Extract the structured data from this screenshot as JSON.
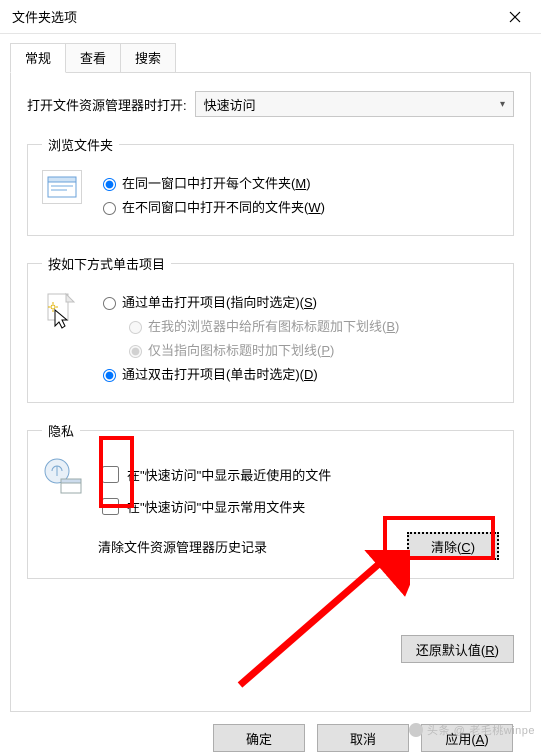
{
  "window": {
    "title": "文件夹选项"
  },
  "tabs": {
    "general": "常规",
    "view": "查看",
    "search": "搜索"
  },
  "open": {
    "label": "打开文件资源管理器时打开:",
    "value": "快速访问"
  },
  "browse": {
    "legend": "浏览文件夹",
    "same": "在同一窗口中打开每个文件夹(",
    "same_m": "M",
    "same_end": ")",
    "new": "在不同窗口中打开不同的文件夹(",
    "new_w": "W",
    "new_end": ")"
  },
  "click": {
    "legend": "按如下方式单击项目",
    "single": "通过单击打开项目(指向时选定)(",
    "single_s": "S",
    "single_end": ")",
    "sub1": "在我的浏览器中给所有图标标题加下划线(",
    "sub1_b": "B",
    "sub1_end": ")",
    "sub2": "仅当指向图标标题时加下划线(",
    "sub2_p": "P",
    "sub2_end": ")",
    "double": "通过双击打开项目(单击时选定)(",
    "double_d": "D",
    "double_end": ")"
  },
  "privacy": {
    "legend": "隐私",
    "chk1": "在\"快速访问\"中显示最近使用的文件",
    "chk2": "在\"快速访问\"中显示常用文件夹",
    "history": "清除文件资源管理器历史记录",
    "clear": "清除(",
    "clear_c": "C",
    "clear_end": ")"
  },
  "restore": {
    "label": "还原默认值(",
    "r": "R",
    "end": ")"
  },
  "footer": {
    "ok": "确定",
    "cancel": "取消",
    "apply": "应用(",
    "apply_a": "A",
    "apply_end": ")"
  },
  "watermark": {
    "prefix": "头条 @",
    "name": "老毛桃winpe"
  }
}
